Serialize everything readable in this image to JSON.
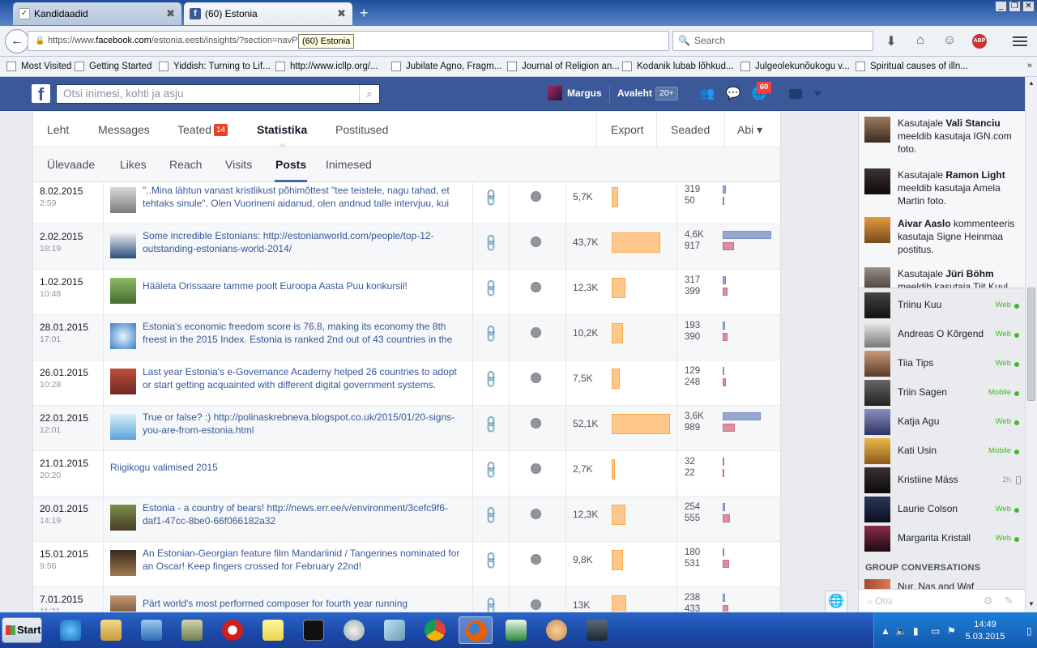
{
  "browser": {
    "tabs": [
      {
        "title": "Kandidaadid",
        "active": false
      },
      {
        "title": "(60) Estonia",
        "active": true
      }
    ],
    "url_prefix": "https://www.",
    "url_domain": "facebook.com",
    "url_rest": "/estonia.eesti/insights/?section=navP",
    "url_tooltip": "(60) Estonia",
    "search_placeholder": "Search",
    "bookmarks": [
      "Most Visited",
      "Getting Started",
      "Yiddish: Turning to Lif...",
      "http://www.icllp.org/...",
      "Jubilate Agno, Fragm...",
      "Journal of Religion an...",
      "Kodanik lubab lõhkud...",
      "Julgeolekunõukogu v...",
      "Spiritual causes of illn..."
    ]
  },
  "fbbar": {
    "search_placeholder": "Otsi inimesi, kohti ja asju",
    "user": "Margus",
    "home": "Avaleht",
    "home_badge": "20+",
    "notif_badge": "60"
  },
  "page_tabs": [
    {
      "label": "Leht",
      "active": false
    },
    {
      "label": "Messages",
      "active": false
    },
    {
      "label": "Teated",
      "active": false,
      "badge": "14"
    },
    {
      "label": "Statistika",
      "active": true
    },
    {
      "label": "Postitused",
      "active": false
    },
    {
      "label": "Export",
      "active": false
    },
    {
      "label": "Seaded",
      "active": false
    },
    {
      "label": "Abi ▾",
      "active": false
    }
  ],
  "sub_tabs": [
    {
      "label": "Ülevaade",
      "active": false
    },
    {
      "label": "Likes",
      "active": false
    },
    {
      "label": "Reach",
      "active": false
    },
    {
      "label": "Visits",
      "active": false
    },
    {
      "label": "Posts",
      "active": true
    },
    {
      "label": "Inimesed",
      "active": false
    }
  ],
  "posts": [
    {
      "date": "8.02.2015",
      "time": "2:59",
      "text": "\"..Mina lähtun vanast kristlikust põhimõttest \"tee teistele, nagu tahad, et tehtaks sinule\". Olen Vuorineni aidanud, olen andnud talle intervjuu, kui",
      "reach": "5,7K",
      "reach_value": 5700,
      "clicks": "319",
      "engagement": "50",
      "clicks_value": 319,
      "engagement_value": 50,
      "thumb": true
    },
    {
      "date": "2.02.2015",
      "time": "18:19",
      "text": "Some incredible Estonians: http://estonianworld.com/people/top-12-outstanding-estonians-world-2014/",
      "reach": "43,7K",
      "reach_value": 43700,
      "clicks": "4,6K",
      "engagement": "917",
      "clicks_value": 4600,
      "engagement_value": 917,
      "thumb": true
    },
    {
      "date": "1.02.2015",
      "time": "10:48",
      "text": "Hääleta Orissaare tamme poolt Euroopa Aasta Puu konkursil!",
      "reach": "12,3K",
      "reach_value": 12300,
      "clicks": "317",
      "engagement": "399",
      "clicks_value": 317,
      "engagement_value": 399,
      "thumb": true
    },
    {
      "date": "28.01.2015",
      "time": "17:01",
      "text": "Estonia's economic freedom score is 76.8, making its economy the 8th freest in the 2015 Index. Estonia is ranked 2nd out of 43 countries in the",
      "reach": "10,2K",
      "reach_value": 10200,
      "clicks": "193",
      "engagement": "390",
      "clicks_value": 193,
      "engagement_value": 390,
      "thumb": true
    },
    {
      "date": "26.01.2015",
      "time": "10:28",
      "text": "Last year Estonia's e-Governance Academy helped 26 countries to adopt or start getting acquainted with different digital government systems.",
      "reach": "7,5K",
      "reach_value": 7500,
      "clicks": "129",
      "engagement": "248",
      "clicks_value": 129,
      "engagement_value": 248,
      "thumb": true
    },
    {
      "date": "22.01.2015",
      "time": "12:01",
      "text": "True or false? :) http://polinaskrebneva.blogspot.co.uk/2015/01/20-signs-you-are-from-estonia.html",
      "reach": "52,1K",
      "reach_value": 52100,
      "clicks": "3,6K",
      "engagement": "989",
      "clicks_value": 3600,
      "engagement_value": 989,
      "thumb": true
    },
    {
      "date": "21.01.2015",
      "time": "20:20",
      "text": "Riigikogu valimised 2015",
      "reach": "2,7K",
      "reach_value": 2700,
      "clicks": "32",
      "engagement": "22",
      "clicks_value": 32,
      "engagement_value": 22,
      "thumb": false
    },
    {
      "date": "20.01.2015",
      "time": "14:19",
      "text": "Estonia - a country of bears! http://news.err.ee/v/environment/3cefc9f6-daf1-47cc-8be0-66f066182a32",
      "reach": "12,3K",
      "reach_value": 12300,
      "clicks": "254",
      "engagement": "555",
      "clicks_value": 254,
      "engagement_value": 555,
      "thumb": true
    },
    {
      "date": "15.01.2015",
      "time": "9:56",
      "text": "An Estonian-Georgian feature film Mandariinid / Tangerines nominated for an Oscar! Keep fingers crossed for February 22nd!",
      "reach": "9,8K",
      "reach_value": 9800,
      "clicks": "180",
      "engagement": "531",
      "clicks_value": 180,
      "engagement_value": 531,
      "thumb": true
    },
    {
      "date": "7.01.2015",
      "time": "11:21",
      "text": "Pärt world's most performed composer for fourth year running",
      "reach": "13K",
      "reach_value": 13000,
      "clicks": "238",
      "engagement": "433",
      "clicks_value": 238,
      "engagement_value": 433,
      "thumb": true
    }
  ],
  "ticker": [
    {
      "pre": "Kasutajale ",
      "name": "Vali Stanciu",
      "post": " meeldib kasutaja IGN.com foto."
    },
    {
      "pre": "Kasutajale ",
      "name": "Ramon Light",
      "post": " meeldib kasutaja Amela Martin foto."
    },
    {
      "pre": "",
      "name": "Aivar Aaslo",
      "post": " kommenteeris kasutaja Signe Heinmaa postitus."
    },
    {
      "pre": "Kasutajale ",
      "name": "Jüri Böhm",
      "post": " meeldib kasutaja Tiit Kuul"
    }
  ],
  "chat": [
    {
      "name": "Triinu Kuu",
      "status": "Web"
    },
    {
      "name": "Andreas O Kõrgend",
      "status": "Web"
    },
    {
      "name": "Tiia Tips",
      "status": "Web"
    },
    {
      "name": "Triin Sagen",
      "status": "Mobile"
    },
    {
      "name": "Katja Agu",
      "status": "Web"
    },
    {
      "name": "Kati Usin",
      "status": "Mobile"
    },
    {
      "name": "Kristiine Mäss",
      "status": "2h"
    },
    {
      "name": "Laurie Colson",
      "status": "Web"
    },
    {
      "name": "Margarita Kristall",
      "status": "Web"
    }
  ],
  "group_header": "GROUP CONVERSATIONS",
  "group_name": "Nur, Nas and Waf",
  "chat_search_placeholder": "Otsi",
  "taskbar": {
    "start": "Start",
    "time": "14:49",
    "date": "5.03.2015"
  },
  "colors": {
    "fb_blue": "#3b5998",
    "reach_bar": "#ffc78b",
    "clicks_bar": "#96a7d1",
    "engagement_bar": "#db8fa3"
  }
}
